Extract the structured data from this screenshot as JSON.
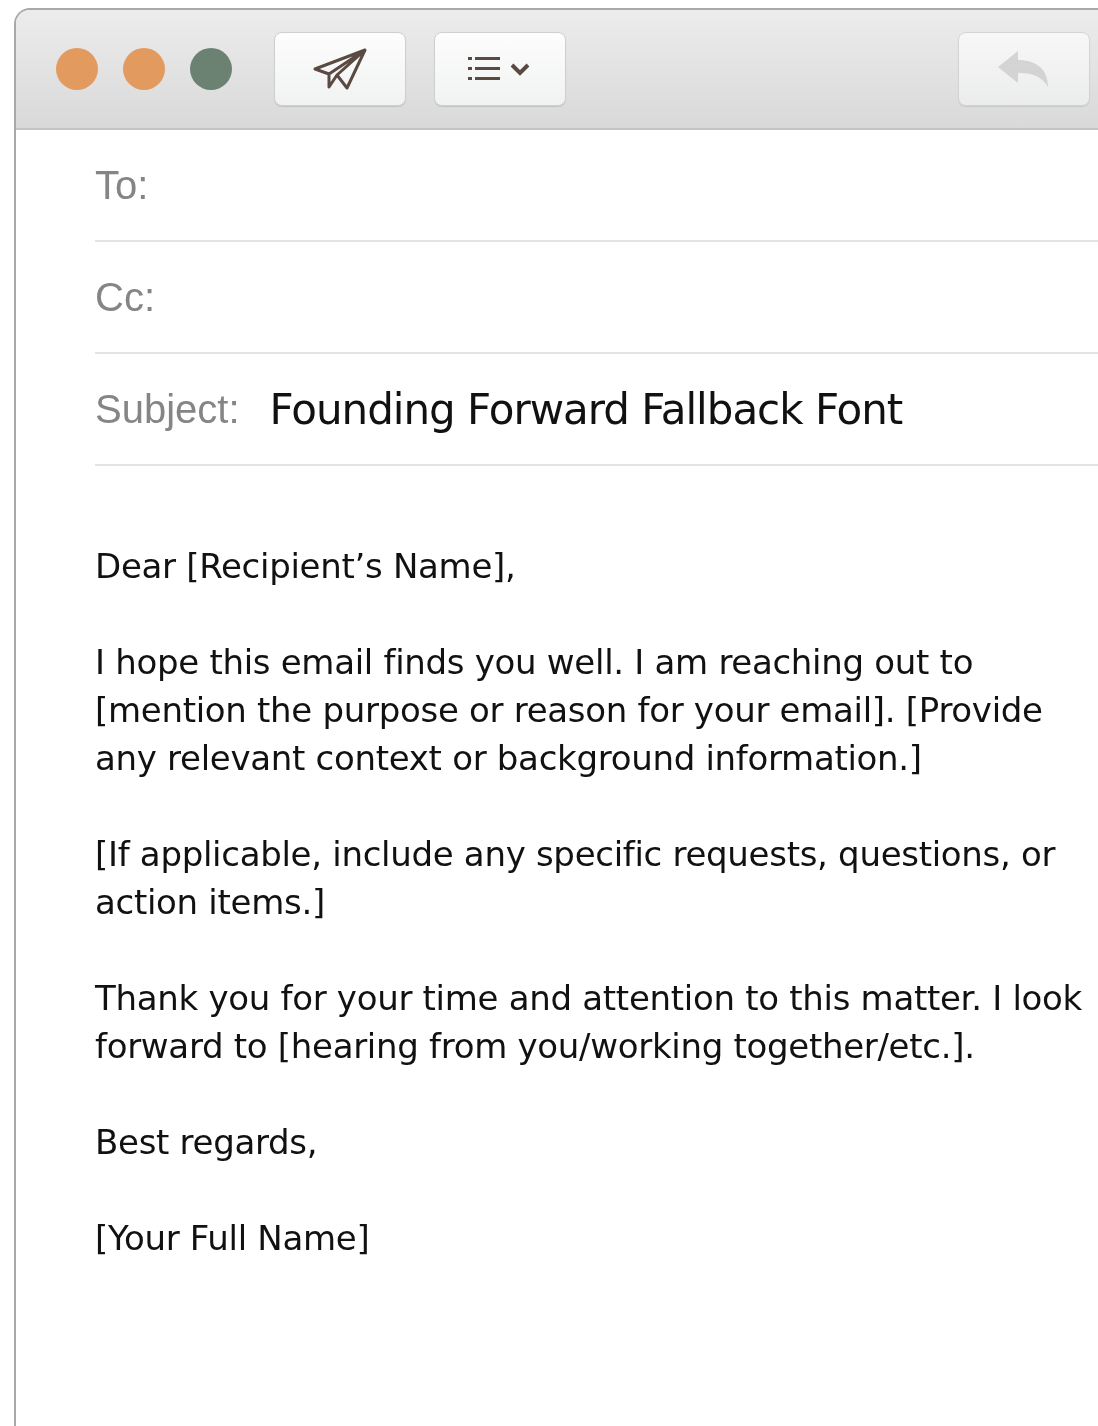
{
  "window": {
    "controls": [
      {
        "color": "#e39a5e"
      },
      {
        "color": "#e39a5e"
      },
      {
        "color": "#6b8273"
      }
    ]
  },
  "toolbar": {
    "buttons": [
      {
        "kind": "send",
        "disabled": false
      },
      {
        "kind": "format",
        "disabled": false
      },
      {
        "kind": "reply",
        "disabled": true
      }
    ]
  },
  "fields": [
    {
      "label": "To:"
    },
    {
      "label": "Cc:"
    },
    {
      "label": "Subject:",
      "value": "Founding Forward Fallback Font"
    }
  ],
  "body": {
    "paragraphs": [
      "Dear [Recipient’s Name],",
      "I hope this email finds you well. I am reaching out to [mention the purpose or reason for your email]. [Provide any relevant context or background information.]",
      "[If applicable, include any specific requests, questions, or action items.]",
      "Thank you for your time and attention to this matter. I look forward to [hearing from you/working together/etc.].",
      "Best regards,",
      "[Your Full Name]"
    ]
  }
}
